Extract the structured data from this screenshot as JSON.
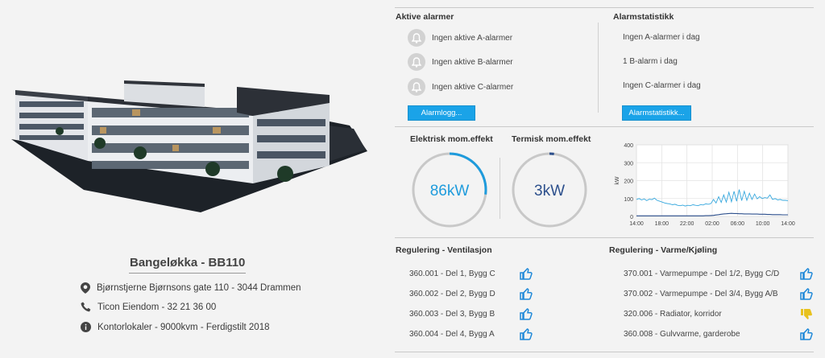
{
  "building": {
    "title": "Bangeløkka - BB110",
    "address": "Bjørnstjerne Bjørnsons gate 110 - 3044 Drammen",
    "contact": "Ticon Eiendom - 32 21 36 00",
    "info": "Kontorlokaler - 9000kvm - Ferdigstilt 2018"
  },
  "alarms": {
    "title": "Aktive alarmer",
    "rows": [
      "Ingen aktive A-alarmer",
      "Ingen aktive B-alarmer",
      "Ingen aktive C-alarmer"
    ],
    "button": "Alarmlogg..."
  },
  "stats": {
    "title": "Alarmstatistikk",
    "rows": [
      "Ingen A-alarmer i dag",
      "1 B-alarm i dag",
      "Ingen C-alarmer i dag"
    ],
    "button": "Alarmstatistikk..."
  },
  "gauges": {
    "electric": {
      "label": "Elektrisk mom.effekt",
      "value": "86kW",
      "fraction": 0.27
    },
    "thermal": {
      "label": "Termisk mom.effekt",
      "value": "3kW",
      "fraction": 0.02
    }
  },
  "chart_data": {
    "type": "line",
    "ylabel": "kW",
    "ylim": [
      0,
      400
    ],
    "yticks": [
      "0",
      "100",
      "200",
      "300",
      "400"
    ],
    "xticks": [
      "14:00",
      "18:00",
      "22:00",
      "02:00",
      "06:00",
      "10:00",
      "14:00"
    ],
    "series": [
      {
        "values": [
          95,
          100,
          92,
          98,
          88,
          96,
          94,
          102,
          90,
          85,
          80,
          75,
          72,
          70,
          65,
          68,
          62,
          60,
          63,
          58,
          62,
          60,
          65,
          62,
          60,
          66,
          64,
          70,
          68,
          72,
          95,
          75,
          110,
          78,
          120,
          80,
          135,
          82,
          140,
          85,
          150,
          88,
          140,
          90,
          130,
          95,
          125,
          98,
          110,
          100,
          105,
          102,
          120,
          95,
          100,
          92,
          95,
          90,
          90,
          88
        ]
      },
      {
        "values": [
          3,
          3,
          3,
          3,
          3,
          3,
          3,
          3,
          3,
          3,
          3,
          3,
          3,
          3,
          3,
          3,
          3,
          3,
          3,
          3,
          3,
          3,
          3,
          3,
          3,
          3,
          3,
          4,
          4,
          5,
          6,
          8,
          10,
          12,
          14,
          15,
          16,
          17,
          16,
          16,
          15,
          15,
          14,
          14,
          14,
          13,
          13,
          13,
          12,
          12,
          12,
          11,
          11,
          10,
          10,
          10,
          10,
          9,
          9,
          9
        ]
      }
    ],
    "colors": [
      "#37a8de",
      "#2c4f8c"
    ]
  },
  "ventilation": {
    "title": "Regulering - Ventilasjon",
    "rows": [
      {
        "label": "360.001 - Del 1, Bygg C",
        "status": "ok"
      },
      {
        "label": "360.002 - Del 2, Bygg D",
        "status": "ok"
      },
      {
        "label": "360.003 - Del 3, Bygg B",
        "status": "ok"
      },
      {
        "label": "360.004 - Del 4, Bygg A",
        "status": "ok"
      }
    ]
  },
  "heating": {
    "title": "Regulering - Varme/Kjøling",
    "rows": [
      {
        "label": "370.001 - Varmepumpe - Del 1/2, Bygg C/D",
        "status": "ok"
      },
      {
        "label": "370.002 - Varmepumpe - Del 3/4, Bygg A/B",
        "status": "ok"
      },
      {
        "label": "320.006 - Radiator, korridor",
        "status": "warn"
      },
      {
        "label": "360.008 - Gulvvarme, garderobe",
        "status": "ok"
      }
    ]
  },
  "colors": {
    "accent": "#1aa3e8",
    "ok": "#1e88d8",
    "warn": "#e8c21e"
  }
}
